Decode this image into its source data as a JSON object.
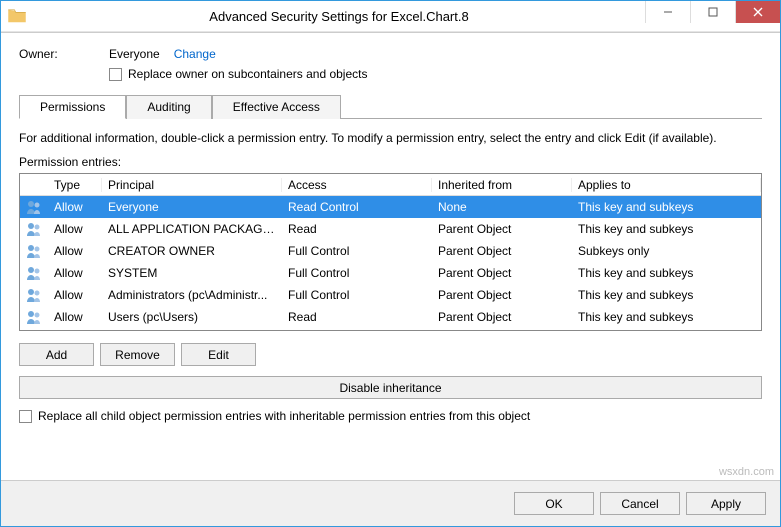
{
  "window": {
    "title": "Advanced Security Settings for Excel.Chart.8"
  },
  "owner": {
    "label": "Owner:",
    "value": "Everyone",
    "change": "Change",
    "replace_checkbox": "Replace owner on subcontainers and objects"
  },
  "tabs": {
    "permissions": "Permissions",
    "auditing": "Auditing",
    "effective": "Effective Access"
  },
  "panel": {
    "info": "For additional information, double-click a permission entry. To modify a permission entry, select the entry and click Edit (if available).",
    "entries_label": "Permission entries:"
  },
  "columns": {
    "type": "Type",
    "principal": "Principal",
    "access": "Access",
    "inherited": "Inherited from",
    "applies": "Applies to"
  },
  "rows": [
    {
      "type": "Allow",
      "principal": "Everyone",
      "access": "Read Control",
      "inherited": "None",
      "applies": "This key and subkeys",
      "selected": true
    },
    {
      "type": "Allow",
      "principal": "ALL APPLICATION PACKAGES",
      "access": "Read",
      "inherited": "Parent Object",
      "applies": "This key and subkeys",
      "selected": false
    },
    {
      "type": "Allow",
      "principal": "CREATOR OWNER",
      "access": "Full Control",
      "inherited": "Parent Object",
      "applies": "Subkeys only",
      "selected": false
    },
    {
      "type": "Allow",
      "principal": "SYSTEM",
      "access": "Full Control",
      "inherited": "Parent Object",
      "applies": "This key and subkeys",
      "selected": false
    },
    {
      "type": "Allow",
      "principal": "Administrators (pc\\Administr...",
      "access": "Full Control",
      "inherited": "Parent Object",
      "applies": "This key and subkeys",
      "selected": false
    },
    {
      "type": "Allow",
      "principal": "Users (pc\\Users)",
      "access": "Read",
      "inherited": "Parent Object",
      "applies": "This key and subkeys",
      "selected": false
    }
  ],
  "buttons": {
    "add": "Add",
    "remove": "Remove",
    "edit": "Edit",
    "disable_inheritance": "Disable inheritance",
    "replace_all": "Replace all child object permission entries with inheritable permission entries from this object",
    "ok": "OK",
    "cancel": "Cancel",
    "apply": "Apply"
  },
  "watermark": "wsxdn.com"
}
